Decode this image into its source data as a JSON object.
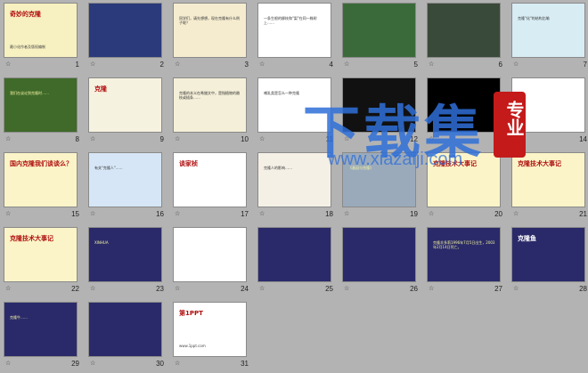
{
  "watermark": {
    "title": "下载集",
    "url": "www.xiazaiji.com",
    "badge": "专业",
    "title_color": "#2f6fd8",
    "badge_color": "#c41a1a"
  },
  "slides": [
    {
      "num": "1",
      "bg": "#f7f0c0",
      "title": "奇妙的克隆",
      "sub": "最小化作者及版权编制"
    },
    {
      "num": "2",
      "bg": "#2a3a7a"
    },
    {
      "num": "3",
      "bg": "#f5ecd0",
      "text": "同学们，请先想想，现在克隆有什么例子呢？"
    },
    {
      "num": "4",
      "bg": "#ffffff",
      "text": "一条生根的柳枝和\"梨\"在同一株树上……"
    },
    {
      "num": "5",
      "bg": "#3a6a3a"
    },
    {
      "num": "6",
      "bg": "#3a4a3a"
    },
    {
      "num": "7",
      "bg": "#d8ecf4",
      "text": "克隆\"化\"的结构比喻"
    },
    {
      "num": "8",
      "bg": "#3f6a2a",
      "text": "我们在谈论到克隆时……"
    },
    {
      "num": "9",
      "bg": "#f6f2e0",
      "title": "克隆"
    },
    {
      "num": "10",
      "bg": "#f4efd8",
      "text": "克隆的本义在希腊文中，是指植物的嫩枝或插条……"
    },
    {
      "num": "11",
      "bg": "#ffffff",
      "text": "哺乳类是怎么一种克隆"
    },
    {
      "num": "12",
      "bg": "#111111"
    },
    {
      "num": "13",
      "bg": "#000000"
    },
    {
      "num": "14",
      "bg": "#ffffff"
    },
    {
      "num": "15",
      "bg": "#fbf4c8",
      "title": "国内克隆我们谈谈么？"
    },
    {
      "num": "16",
      "bg": "#d6e6f6",
      "text": "有关\"克隆人\"……"
    },
    {
      "num": "17",
      "bg": "#ffffff",
      "title": "谈家桢"
    },
    {
      "num": "18",
      "bg": "#f4f0e6",
      "text": "克隆人的影响……"
    },
    {
      "num": "19",
      "bg": "#9aaabb",
      "text": "《基因与克隆》"
    },
    {
      "num": "20",
      "bg": "#fbf4c8",
      "title": "克隆技术大事记"
    },
    {
      "num": "21",
      "bg": "#fbf4c8",
      "title": "克隆技术大事记"
    },
    {
      "num": "22",
      "bg": "#fbf4c8",
      "title": "克隆技术大事记"
    },
    {
      "num": "23",
      "bg": "#2a2a6a",
      "text": "XINHUA"
    },
    {
      "num": "24",
      "bg": "#ffffff"
    },
    {
      "num": "25",
      "bg": "#2a2a6a"
    },
    {
      "num": "26",
      "bg": "#2a2a6a"
    },
    {
      "num": "27",
      "bg": "#2a2a6a",
      "text": "克隆羊多莉1996年7月5日出生，2003年2月14日死亡。"
    },
    {
      "num": "28",
      "bg": "#2a2a6a",
      "title": "克隆鱼"
    },
    {
      "num": "29",
      "bg": "#2a2a6a",
      "text": "克隆牛……"
    },
    {
      "num": "30",
      "bg": "#2a2a6a"
    },
    {
      "num": "31",
      "bg": "#ffffff",
      "title": "第1PPT",
      "sub": "www.1ppt.com"
    }
  ]
}
